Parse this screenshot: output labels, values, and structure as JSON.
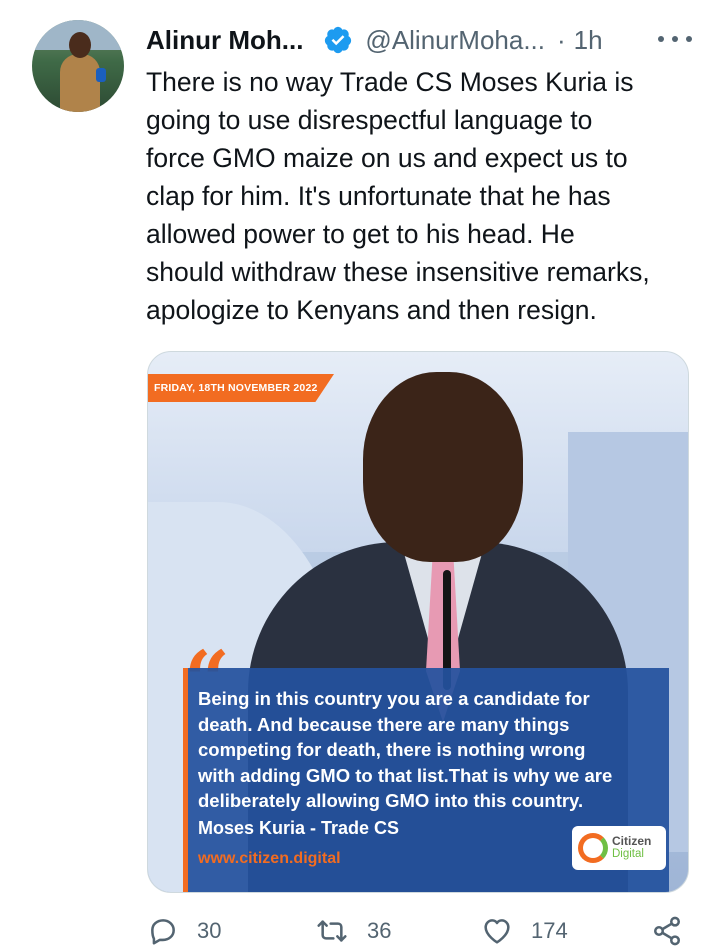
{
  "tweet": {
    "author_name": "Alinur Moh...",
    "handle": "@AlinurMoha...",
    "separator": "·",
    "time": "1h",
    "text": "There is no way Trade CS Moses Kuria is\ngoing to use disrespectful language to\nforce GMO maize on us and expect us to\nclap for him. It's unfortunate that he has\nallowed power to get to his head. He\nshould withdraw these insensitive remarks,\napologize to Kenyans and then resign."
  },
  "media": {
    "date_tag": "FRIDAY, 18TH NOVEMBER 2022",
    "quote": "Being in this country you are a candidate for\ndeath. And because there are many things\ncompeting for death, there is nothing wrong\nwith adding GMO to that list.That is why we are\ndeliberately allowing GMO into this country.",
    "author": "Moses Kuria - Trade CS",
    "url": "www.citizen.digital",
    "logo_line1": "Citizen",
    "logo_line2": "Digital"
  },
  "actions": {
    "replies": "30",
    "retweets": "36",
    "likes": "174"
  },
  "colors": {
    "accent_orange": "#f26c21",
    "quote_blue": "#23529e",
    "verified_blue": "#1d9bf0",
    "muted": "#536471"
  }
}
